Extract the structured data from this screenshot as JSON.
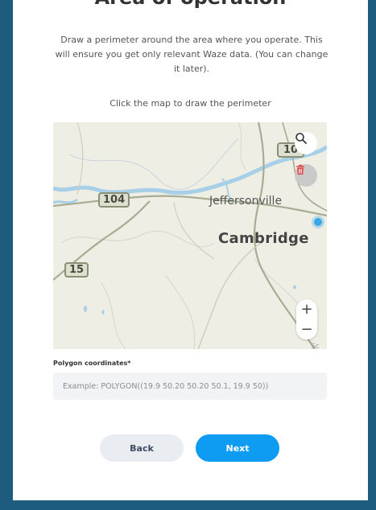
{
  "page": {
    "title": "Area of operation",
    "intro": "Draw a perimeter around the area where you operate. This will ensure you get only relevant Waze data. (You can change it later).",
    "map_hint": "Click the map to draw the perimeter"
  },
  "map": {
    "towns": [
      "Jeffersonville",
      "Cambridge"
    ],
    "route_shields": [
      "104",
      "15",
      "10"
    ],
    "zoom_in": "+",
    "zoom_out": "−",
    "credit": "Sc",
    "icons": [
      "search-icon",
      "trash-icon",
      "location-dot"
    ]
  },
  "form": {
    "polygon_label": "Polygon coordinates*",
    "polygon_value": "",
    "polygon_placeholder": "Example: POLYGON((19.9 50.20 50.20 50.1, 19.9 50))"
  },
  "buttons": {
    "back": "Back",
    "next": "Next"
  },
  "colors": {
    "frame": "#1d5b7f",
    "accent": "#0e9bf2",
    "secondary_button": "#e9ecf1"
  }
}
